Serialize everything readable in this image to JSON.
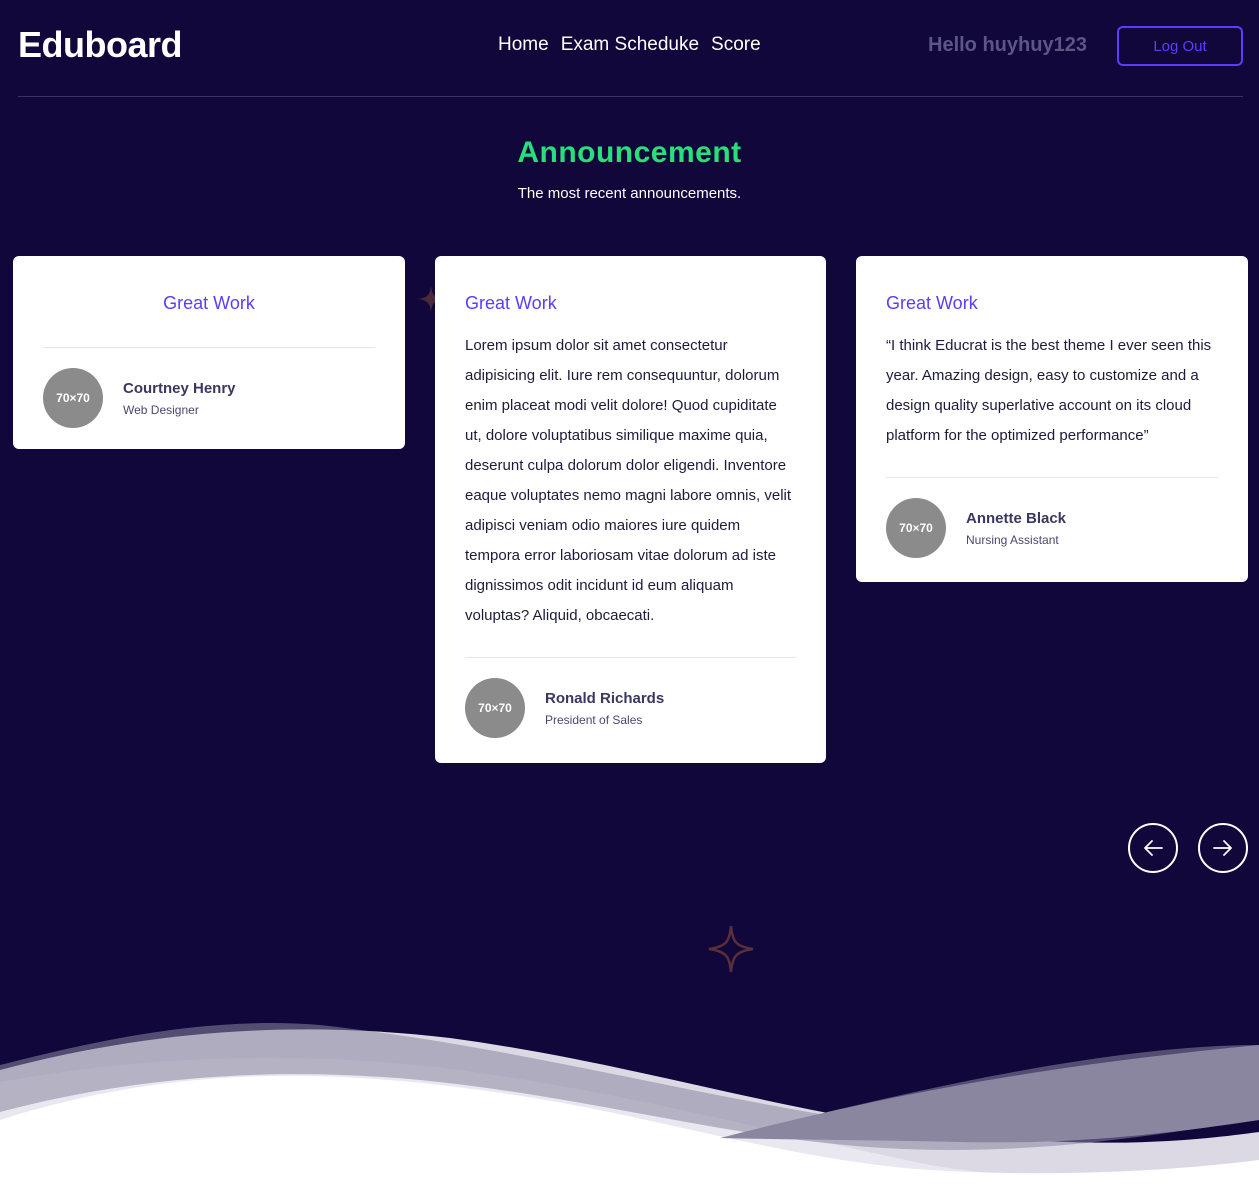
{
  "header": {
    "brand": "Eduboard",
    "nav": [
      "Home",
      "Exam Scheduke",
      "Score"
    ],
    "greeting": "Hello huyhuy123",
    "logout_label": "Log Out"
  },
  "section": {
    "title": "Announcement",
    "subtitle": "The most recent announcements."
  },
  "cards": [
    {
      "title": "Great Work",
      "text": "",
      "avatar": "70×70",
      "name": "Courtney Henry",
      "role": "Web Designer"
    },
    {
      "title": "Great Work",
      "text": "Lorem ipsum dolor sit amet consectetur adipisicing elit. Iure rem consequuntur, dolorum enim placeat modi velit dolore! Quod cupiditate ut, dolore voluptatibus similique maxime quia, deserunt culpa dolorum dolor eligendi. Inventore eaque voluptates nemo magni labore omnis, velit adipisci veniam odio maiores iure quidem tempora error laboriosam vitae dolorum ad iste dignissimos odit incidunt id eum aliquam voluptas? Aliquid, obcaecati.",
      "avatar": "70×70",
      "name": "Ronald Richards",
      "role": "President of Sales"
    },
    {
      "title": "Great Work",
      "text": "“I think Educrat is the best theme I ever seen this year. Amazing design, easy to customize and a design quality superlative account on its cloud platform for the optimized performance”",
      "avatar": "70×70",
      "name": "Annette Black",
      "role": "Nursing Assistant"
    }
  ],
  "icons": {
    "prev": "arrow-left-icon",
    "next": "arrow-right-icon",
    "decor": "sparkle-icon"
  },
  "colors": {
    "background": "#12073a",
    "accent": "#5a3dff",
    "title_green": "#27e07a"
  }
}
